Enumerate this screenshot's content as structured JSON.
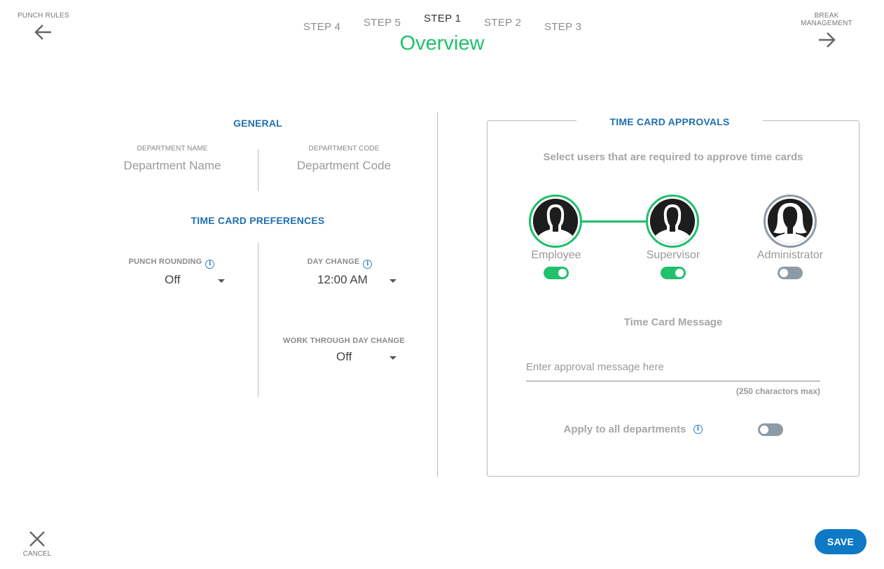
{
  "nav": {
    "prev_label": "PUNCH RULES",
    "next_label": "BREAK MANAGEMENT",
    "steps": [
      "STEP 4",
      "STEP 5",
      "STEP 1",
      "STEP 2",
      "STEP 3"
    ],
    "active_step": "STEP 1",
    "page_title": "Overview",
    "prev_icon": "arrow-left-icon",
    "next_icon": "arrow-right-icon"
  },
  "general": {
    "heading": "GENERAL",
    "department_name_label": "DEPARTMENT NAME",
    "department_name_placeholder": "Department Name",
    "department_code_label": "DEPARTMENT CODE",
    "department_code_placeholder": "Department Code"
  },
  "preferences": {
    "heading": "TIME CARD PREFERENCES",
    "punch_rounding_label": "PUNCH ROUNDING",
    "punch_rounding_value": "Off",
    "day_change_label": "DAY CHANGE",
    "day_change_value": "12:00 AM",
    "work_through_label": "WORK THROUGH DAY CHANGE",
    "work_through_value": "Off"
  },
  "approvals": {
    "heading": "TIME CARD APPROVALS",
    "subtitle": "Select users that are required to approve time cards",
    "roles": [
      {
        "label": "Employee",
        "enabled": true,
        "avatar": "male-silhouette-icon"
      },
      {
        "label": "Supervisor",
        "enabled": true,
        "avatar": "male-silhouette-icon"
      },
      {
        "label": "Administrator",
        "enabled": false,
        "avatar": "female-silhouette-icon"
      }
    ],
    "message_heading": "Time Card Message",
    "message_placeholder": "Enter approval message here",
    "message_hint": "(250 charactors max)",
    "apply_all_label": "Apply to all departments",
    "apply_all_enabled": false
  },
  "footer": {
    "cancel_label": "CANCEL",
    "cancel_icon": "close-icon",
    "save_label": "SAVE"
  },
  "colors": {
    "accent_green": "#22c06a",
    "heading_blue": "#1f6fae",
    "save_blue": "#0e79c4",
    "toggle_off": "#8d9ba6"
  }
}
